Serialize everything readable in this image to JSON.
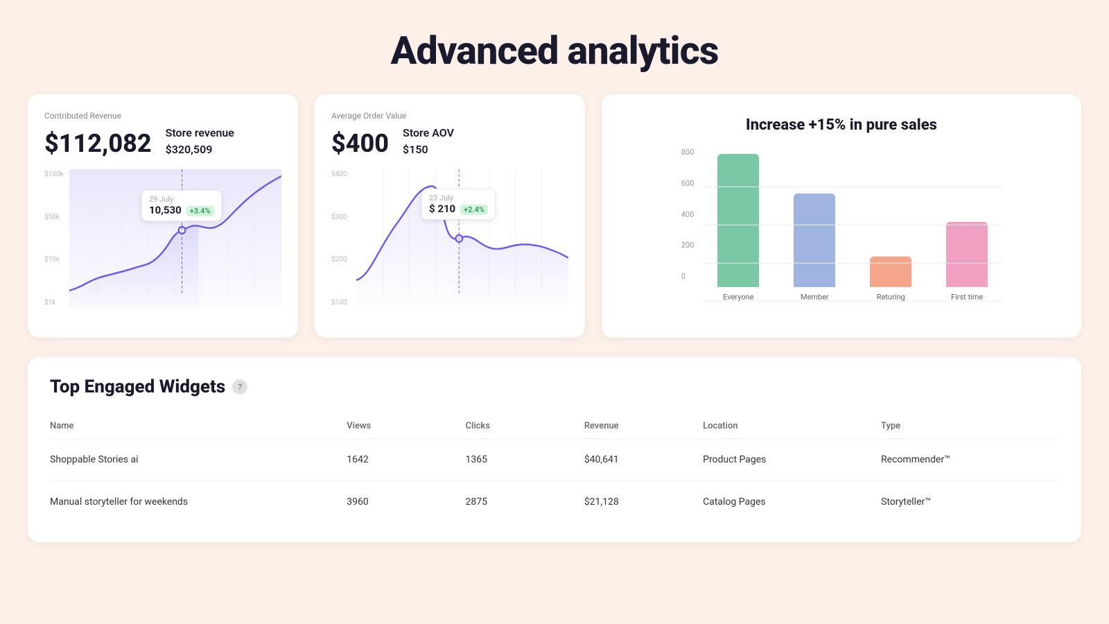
{
  "page": {
    "title": "Advanced analytics",
    "bg_color": "#fdf0e8"
  },
  "revenue_card": {
    "label": "Contributed Revenue",
    "main_value": "$112,082",
    "sub_label": "Store revenue",
    "sub_value": "$320,509",
    "tooltip_date": "29 July",
    "tooltip_value": "10,530",
    "tooltip_pct": "+3.4%",
    "y_labels": [
      "$100k",
      "$50k",
      "$10k",
      "$1k"
    ]
  },
  "aov_card": {
    "label": "Average Order Value",
    "main_value": "$400",
    "sub_label": "Store AOV",
    "sub_value": "$150",
    "tooltip_date": "23 July",
    "tooltip_value": "$ 210",
    "tooltip_pct": "+2.4%",
    "y_labels": [
      "$400",
      "$300",
      "$200",
      "$100"
    ]
  },
  "bar_chart": {
    "title": "Increase +15% in pure sales",
    "y_labels": [
      "800",
      "600",
      "400",
      "200",
      "0"
    ],
    "bars": [
      {
        "label": "Everyone",
        "value": 700,
        "color": "#7bc8a4"
      },
      {
        "label": "Member",
        "value": 490,
        "color": "#a0b4e0"
      },
      {
        "label": "Returing",
        "value": 160,
        "color": "#f4a58a"
      },
      {
        "label": "First time",
        "value": 340,
        "color": "#f0a0c0"
      }
    ],
    "max_value": 800
  },
  "widgets_table": {
    "title": "Top Engaged Widgets",
    "help_icon": "?",
    "columns": [
      "Name",
      "Views",
      "Clicks",
      "Revenue",
      "Location",
      "Type"
    ],
    "rows": [
      {
        "name": "Shoppable Stories ai",
        "views": "1642",
        "clicks": "1365",
        "revenue": "$40,641",
        "location": "Product Pages",
        "type": "Recommender™"
      },
      {
        "name": "Manual storyteller for weekends",
        "views": "3960",
        "clicks": "2875",
        "revenue": "$21,128",
        "location": "Catalog Pages",
        "type": "Storyteller™"
      }
    ]
  }
}
